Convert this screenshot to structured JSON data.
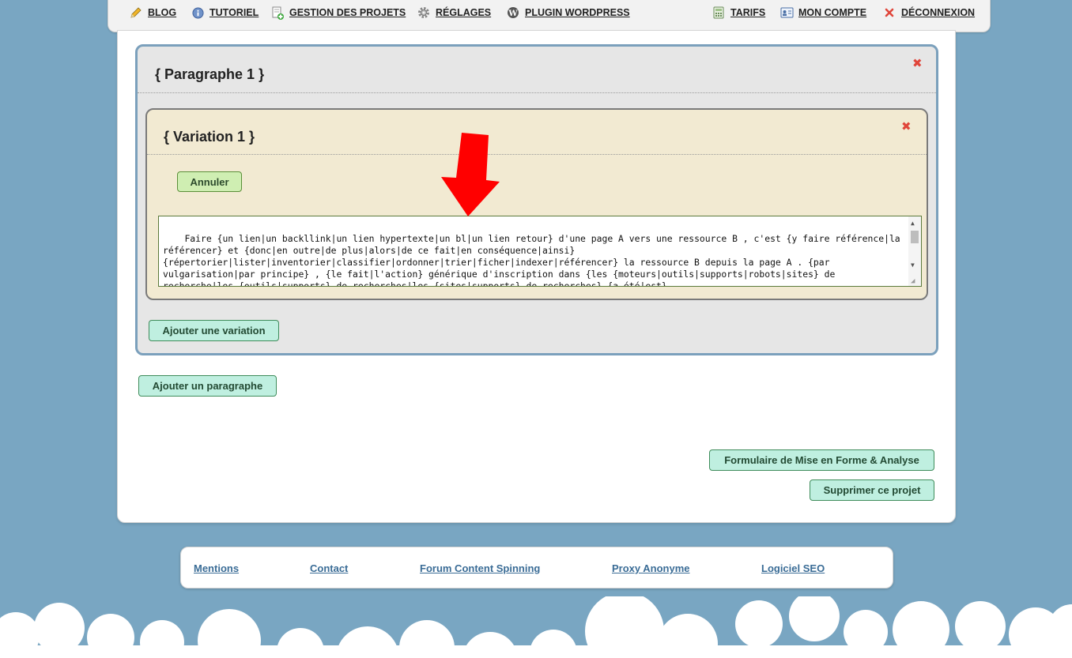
{
  "nav": {
    "blog": "BLOG",
    "tutoriel": "TUTORIEL",
    "gestion": "GESTION DES PROJETS",
    "reglages": "RÉGLAGES",
    "plugin": "PLUGIN WORDPRESS",
    "tarifs": "TARIFS",
    "compte": "MON COMPTE",
    "deconnexion": "DÉCONNEXION"
  },
  "paragraph": {
    "title": "{ Paragraphe 1 }",
    "add_variation_label": "Ajouter une variation"
  },
  "variation": {
    "title": "{ Variation 1 }",
    "cancel_label": "Annuler",
    "text": "Faire {un lien|un backllink|un lien hypertexte|un bl|un lien retour} d'une page A vers une ressource B , c'est {y faire référence|la référencer} et {donc|en outre|de plus|alors|de ce fait|en conséquence|ainsi} {répertorier|lister|inventorier|classifier|ordonner|trier|ficher|indexer|référencer} la ressource B depuis la page A . {par vulgarisation|par principe} , {le fait|l'action} générique d'inscription dans {les {moteurs|outils|supports|robots|sites} de recherche|les {outils|supports} de recherches|les {sites|supports} de recherches} {a été|est} {qualifiée|baptisée|appelée|désignée|dénommée|prénommée|surnommée} référencement . {aujourd'hui|à présent|maintenant} , ça"
  },
  "actions": {
    "add_paragraph_label": "Ajouter un paragraphe",
    "form_label": "Formulaire de Mise en Forme & Analyse",
    "delete_label": "Supprimer ce projet"
  },
  "footer": {
    "mentions": "Mentions",
    "contact": "Contact",
    "forum": "Forum Content Spinning",
    "proxy": "Proxy Anonyme",
    "logiciel": "Logiciel SEO"
  },
  "colors": {
    "background": "#79a6c2",
    "paragraph_border": "#7ba0bc",
    "variation_bg": "#f2ead2",
    "close": "#e0453a",
    "arrow": "#ff0000"
  },
  "icons": {
    "blog": "pencil-icon",
    "tutoriel": "info-icon",
    "gestion": "add-document-icon",
    "reglages": "gear-icon",
    "plugin": "wordpress-icon",
    "tarifs": "calculator-icon",
    "compte": "id-card-icon",
    "deconnexion": "close-icon"
  }
}
